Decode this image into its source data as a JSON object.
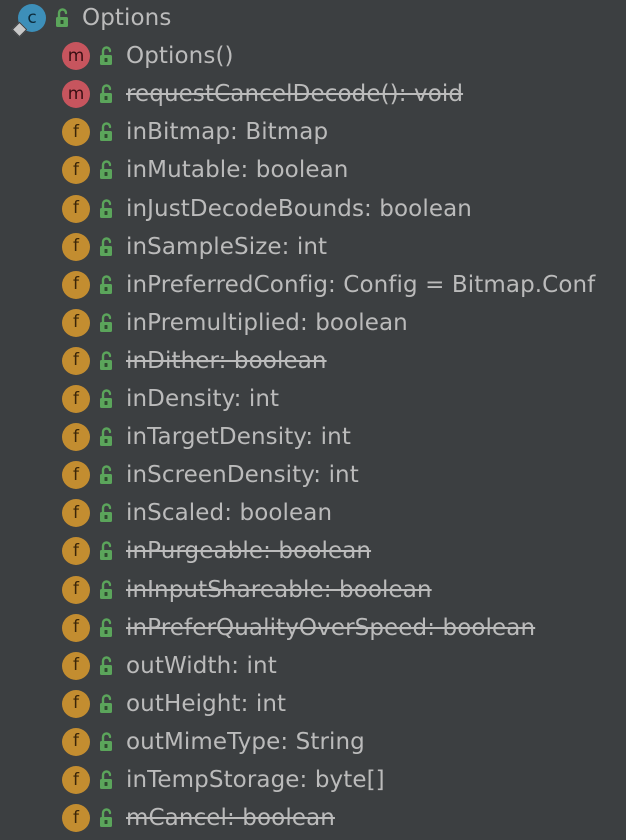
{
  "root": {
    "label": "Options",
    "icon_letter": "c",
    "icon": "class-icon",
    "expanded": true
  },
  "members": [
    {
      "label": "Options()",
      "kind": "method",
      "icon_letter": "m",
      "deprecated": false
    },
    {
      "label": "requestCancelDecode(): void",
      "kind": "method",
      "icon_letter": "m",
      "deprecated": true
    },
    {
      "label": "inBitmap: Bitmap",
      "kind": "field",
      "icon_letter": "f",
      "deprecated": false
    },
    {
      "label": "inMutable: boolean",
      "kind": "field",
      "icon_letter": "f",
      "deprecated": false
    },
    {
      "label": "inJustDecodeBounds: boolean",
      "kind": "field",
      "icon_letter": "f",
      "deprecated": false
    },
    {
      "label": "inSampleSize: int",
      "kind": "field",
      "icon_letter": "f",
      "deprecated": false
    },
    {
      "label": "inPreferredConfig: Config = Bitmap.Conf",
      "kind": "field",
      "icon_letter": "f",
      "deprecated": false
    },
    {
      "label": "inPremultiplied: boolean",
      "kind": "field",
      "icon_letter": "f",
      "deprecated": false
    },
    {
      "label": "inDither: boolean",
      "kind": "field",
      "icon_letter": "f",
      "deprecated": true
    },
    {
      "label": "inDensity: int",
      "kind": "field",
      "icon_letter": "f",
      "deprecated": false
    },
    {
      "label": "inTargetDensity: int",
      "kind": "field",
      "icon_letter": "f",
      "deprecated": false
    },
    {
      "label": "inScreenDensity: int",
      "kind": "field",
      "icon_letter": "f",
      "deprecated": false
    },
    {
      "label": "inScaled: boolean",
      "kind": "field",
      "icon_letter": "f",
      "deprecated": false
    },
    {
      "label": "inPurgeable: boolean",
      "kind": "field",
      "icon_letter": "f",
      "deprecated": true
    },
    {
      "label": "inInputShareable: boolean",
      "kind": "field",
      "icon_letter": "f",
      "deprecated": true
    },
    {
      "label": "inPreferQualityOverSpeed: boolean",
      "kind": "field",
      "icon_letter": "f",
      "deprecated": true
    },
    {
      "label": "outWidth: int",
      "kind": "field",
      "icon_letter": "f",
      "deprecated": false
    },
    {
      "label": "outHeight: int",
      "kind": "field",
      "icon_letter": "f",
      "deprecated": false
    },
    {
      "label": "outMimeType: String",
      "kind": "field",
      "icon_letter": "f",
      "deprecated": false
    },
    {
      "label": "inTempStorage: byte[]",
      "kind": "field",
      "icon_letter": "f",
      "deprecated": false
    },
    {
      "label": "mCancel: boolean",
      "kind": "field",
      "icon_letter": "f",
      "deprecated": true
    }
  ],
  "colors": {
    "background": "#3c3f41",
    "text": "#bbbbbb",
    "class_icon": "#3d8fb9",
    "method_icon": "#c7555e",
    "field_icon": "#c38d30",
    "public_lock": "#5ba55b"
  },
  "lock_icon": "public-lock-icon"
}
